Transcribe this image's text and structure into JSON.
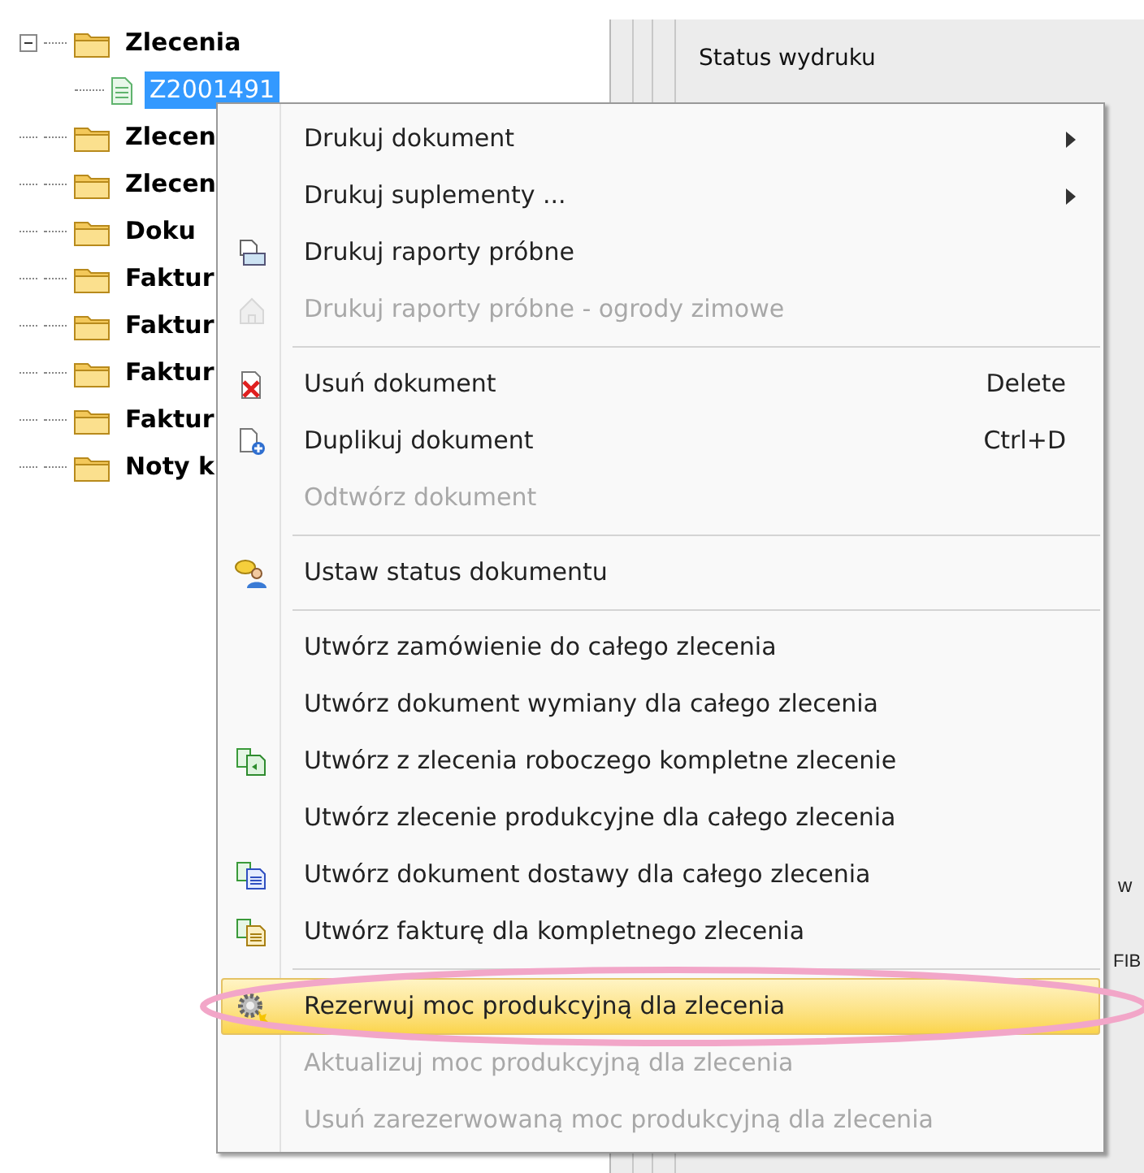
{
  "tree": [
    {
      "label": "Zlecenia",
      "expanded": true,
      "children": [
        {
          "label": "Z2001491",
          "selected": true
        }
      ]
    },
    {
      "label": "Zlecen",
      "expanded": false
    },
    {
      "label": "Zlecen",
      "expanded": false
    },
    {
      "label": "Doku",
      "expanded": false
    },
    {
      "label": "Faktur",
      "expanded": false
    },
    {
      "label": "Faktur",
      "expanded": false
    },
    {
      "label": "Faktur",
      "expanded": false
    },
    {
      "label": "Faktur",
      "expanded": false
    },
    {
      "label": "Noty k",
      "expanded": false
    }
  ],
  "right_pane": {
    "header": "Status wydruku",
    "fragments": [
      "w",
      "FIB"
    ]
  },
  "context_menu": [
    {
      "kind": "item",
      "label": "Drukuj dokument",
      "submenu": true,
      "disabled": false,
      "selected": false
    },
    {
      "kind": "item",
      "label": "Drukuj suplementy ...",
      "submenu": true,
      "disabled": false,
      "selected": false
    },
    {
      "kind": "item",
      "label": "Drukuj raporty próbne",
      "disabled": false,
      "selected": false
    },
    {
      "kind": "item",
      "label": "Drukuj raporty próbne - ogrody zimowe",
      "disabled": true,
      "selected": false
    },
    {
      "kind": "separator"
    },
    {
      "kind": "item",
      "label": "Usuń dokument",
      "shortcut": "Delete",
      "disabled": false,
      "selected": false
    },
    {
      "kind": "item",
      "label": "Duplikuj dokument",
      "shortcut": "Ctrl+D",
      "disabled": false,
      "selected": false
    },
    {
      "kind": "item",
      "label": "Odtwórz dokument",
      "disabled": true,
      "selected": false
    },
    {
      "kind": "separator"
    },
    {
      "kind": "item",
      "label": "Ustaw status dokumentu",
      "disabled": false,
      "selected": false
    },
    {
      "kind": "separator"
    },
    {
      "kind": "item",
      "label": "Utwórz zamówienie do całego zlecenia",
      "disabled": false,
      "selected": false
    },
    {
      "kind": "item",
      "label": "Utwórz dokument wymiany dla całego zlecenia",
      "disabled": false,
      "selected": false
    },
    {
      "kind": "item",
      "label": "Utwórz z zlecenia roboczego kompletne zlecenie",
      "disabled": false,
      "selected": false
    },
    {
      "kind": "item",
      "label": "Utwórz zlecenie produkcyjne dla całego zlecenia",
      "disabled": false,
      "selected": false
    },
    {
      "kind": "item",
      "label": "Utwórz dokument dostawy dla całego zlecenia",
      "disabled": false,
      "selected": false
    },
    {
      "kind": "item",
      "label": "Utwórz fakturę dla kompletnego zlecenia",
      "disabled": false,
      "selected": false
    },
    {
      "kind": "separator"
    },
    {
      "kind": "item",
      "label": "Rezerwuj moc produkcyjną dla zlecenia",
      "disabled": false,
      "selected": true
    },
    {
      "kind": "item",
      "label": "Aktualizuj moc produkcyjną dla zlecenia",
      "disabled": true,
      "selected": false
    },
    {
      "kind": "item",
      "label": "Usuń zarezerwowaną moc produkcyjną dla zlecenia",
      "disabled": true,
      "selected": false
    }
  ]
}
